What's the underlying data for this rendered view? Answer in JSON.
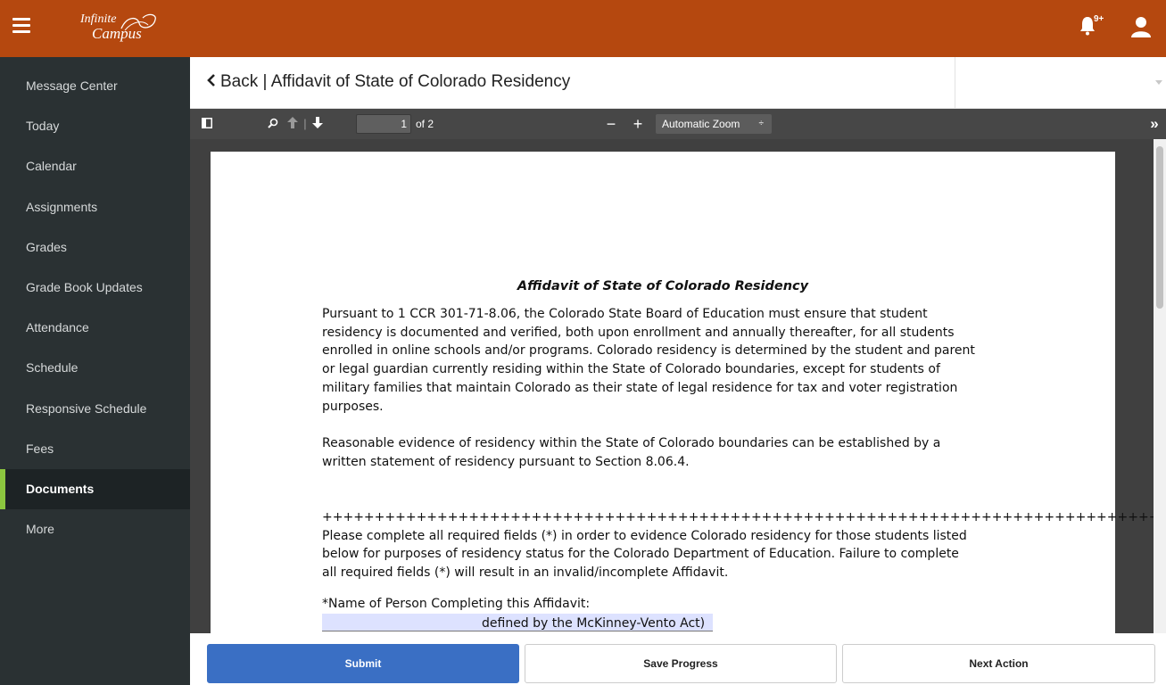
{
  "app": {
    "logo_line1": "Infinite",
    "logo_line2": "Campus",
    "notification_badge": "9+"
  },
  "sidebar": {
    "items": [
      {
        "label": "Message Center"
      },
      {
        "label": "Today"
      },
      {
        "label": "Calendar"
      },
      {
        "label": "Assignments"
      },
      {
        "label": "Grades"
      },
      {
        "label": "Grade Book Updates"
      },
      {
        "label": "Attendance"
      },
      {
        "label": "Schedule"
      },
      {
        "label": "Responsive Schedule"
      },
      {
        "label": "Fees"
      },
      {
        "label": "Documents",
        "active": true
      },
      {
        "label": "More"
      }
    ]
  },
  "header": {
    "back_label": "Back",
    "separator": "|",
    "title": "Affidavit of State of Colorado Residency"
  },
  "pdf_toolbar": {
    "page_number": "1",
    "page_of": "of 2",
    "zoom_label": "Automatic Zoom",
    "zoom_arrow": "÷",
    "zoom_out": "−",
    "zoom_in": "+",
    "more": "»"
  },
  "document": {
    "title": "Affidavit of State of Colorado Residency",
    "para1": [
      "Pursuant to 1 CCR 301-71-8.06, the Colorado State Board of Education must ensure that student",
      "residency is documented and verified, both upon enrollment and annually thereafter, for all students",
      "enrolled in online schools and/or programs. Colorado residency is determined by the student and parent",
      "or legal guardian currently residing within the State of Colorado boundaries, except for students of",
      "military families that maintain Colorado as their state of legal residence for tax and voter registration",
      "purposes."
    ],
    "para2": [
      "Reasonable evidence of residency within the State of Colorado boundaries can be established by a",
      "written statement of residency pursuant to Section 8.06.4."
    ],
    "separator_line": "++++++++++++++++++++++++++++++++++++++++++++++++++++++++++++++++++++++++++++++++++++",
    "para3": [
      "Please complete all required fields (*) in order to evidence Colorado residency for those students listed",
      "below for purposes of residency status for the Colorado Department of Education.  Failure to complete",
      "all required fields (*) will result in an invalid/incomplete Affidavit."
    ],
    "name_field_label": "*Name of Person Completing this Affidavit:",
    "name_field_value": "",
    "cut_line": "defined by the McKinney-Vento Act)"
  },
  "actions": {
    "submit": "Submit",
    "save": "Save Progress",
    "next": "Next Action"
  },
  "colors": {
    "topbar": "#b5480f",
    "sidebar": "#2a3133",
    "active_indicator": "#8cc63f",
    "primary_button": "#3a6fc4"
  }
}
